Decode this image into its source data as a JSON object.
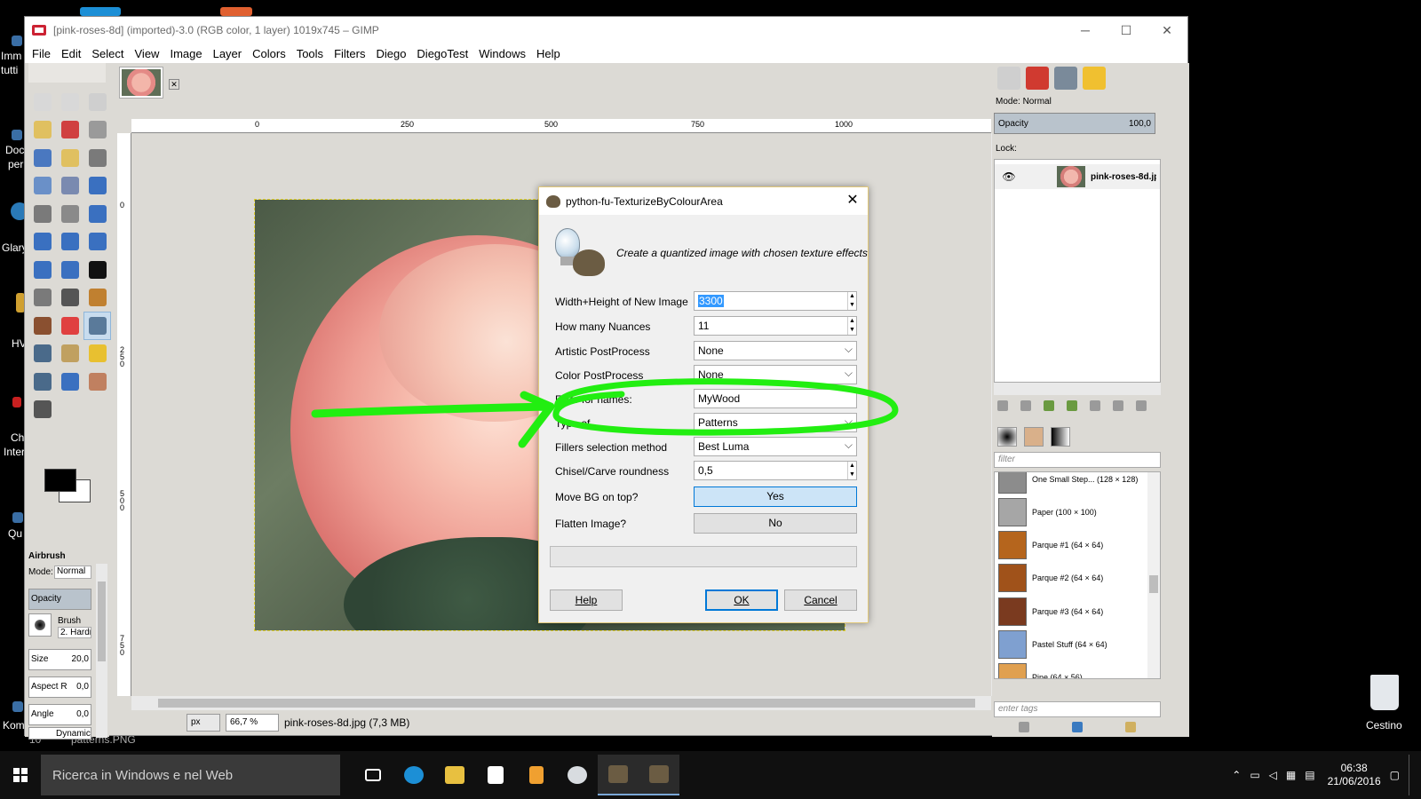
{
  "desktop": {
    "left_labels": [
      "Imm",
      "tutti",
      "Doc",
      "per",
      "Glary",
      "HV",
      "Ch",
      "Inter",
      "Qu",
      "Kom",
      "10"
    ],
    "bottom_label": "patterns.PNG",
    "recycle_bin": "Cestino"
  },
  "window": {
    "title": "[pink-roses-8d] (imported)-3.0 (RGB color, 1 layer) 1019x745 – GIMP",
    "controls": [
      "─",
      "☐",
      "✕"
    ]
  },
  "menu": [
    "File",
    "Edit",
    "Select",
    "View",
    "Image",
    "Layer",
    "Colors",
    "Tools",
    "Filters",
    "Diego",
    "DiegoTest",
    "Windows",
    "Help"
  ],
  "toolbox": {
    "tools": [
      {
        "name": "rect-select-icon",
        "color": "#d8d8d8"
      },
      {
        "name": "ellipse-select-icon",
        "color": "#d8d8d8"
      },
      {
        "name": "free-select-icon",
        "color": "#cfcfcf"
      },
      {
        "name": "fuzzy-select-icon",
        "color": "#e0c060"
      },
      {
        "name": "select-by-color-icon",
        "color": "#d04040"
      },
      {
        "name": "scissors-icon",
        "color": "#9a9a9a"
      },
      {
        "name": "foreground-select-icon",
        "color": "#4a78c0"
      },
      {
        "name": "paths-icon",
        "color": "#e0c060"
      },
      {
        "name": "color-picker-icon",
        "color": "#7a7a7a"
      },
      {
        "name": "zoom-icon",
        "color": "#6a90c8"
      },
      {
        "name": "measure-icon",
        "color": "#7a8ab0"
      },
      {
        "name": "move-icon",
        "color": "#3a70c0"
      },
      {
        "name": "align-icon",
        "color": "#7a7a7a"
      },
      {
        "name": "crop-icon",
        "color": "#8a8a8a"
      },
      {
        "name": "rotate-icon",
        "color": "#3a70c0"
      },
      {
        "name": "scale-icon",
        "color": "#3a70c0"
      },
      {
        "name": "shear-icon",
        "color": "#3a70c0"
      },
      {
        "name": "perspective-icon",
        "color": "#3a70c0"
      },
      {
        "name": "flip-icon",
        "color": "#3a70c0"
      },
      {
        "name": "cage-icon",
        "color": "#3a70c0"
      },
      {
        "name": "text-icon",
        "color": "#111111"
      },
      {
        "name": "bucket-fill-icon",
        "color": "#7a7a7a"
      },
      {
        "name": "blend-icon",
        "color": "#555555"
      },
      {
        "name": "pencil-icon",
        "color": "#c08030"
      },
      {
        "name": "paintbrush-icon",
        "color": "#8a5030"
      },
      {
        "name": "eraser-icon",
        "color": "#e04040"
      },
      {
        "name": "airbrush-icon",
        "color": "#5a7a9a"
      },
      {
        "name": "ink-icon",
        "color": "#4a6a8a"
      },
      {
        "name": "clone-icon",
        "color": "#c0a060"
      },
      {
        "name": "heal-icon",
        "color": "#e8c030"
      },
      {
        "name": "perspective-clone-icon",
        "color": "#4a6a8a"
      },
      {
        "name": "blur-icon",
        "color": "#3a70c0"
      },
      {
        "name": "smudge-icon",
        "color": "#c08060"
      },
      {
        "name": "dodge-burn-icon",
        "color": "#555555"
      }
    ],
    "active_tool_index": 26
  },
  "tool_options": {
    "title": "Airbrush",
    "mode_label": "Mode:",
    "mode_value": "Normal",
    "opacity_label": "Opacity",
    "brush_label": "Brush",
    "brush_name": "2. Hardn",
    "size_label": "Size",
    "size_value": "20,0",
    "aspect_label": "Aspect R",
    "aspect_value": "0,0",
    "angle_label": "Angle",
    "angle_value": "0,0",
    "dynamics_label": "Dynamic"
  },
  "rulers": {
    "h_labels": [
      "0",
      "250",
      "500",
      "750",
      "1000"
    ],
    "v_labels": [
      "0",
      "2 5 0",
      "5 0 0",
      "7 5 0"
    ]
  },
  "status": {
    "unit": "px",
    "zoom": "66,7 %",
    "file": "pink-roses-8d.jpg (7,3 MB)"
  },
  "layers_dock": {
    "mode_label": "Mode:",
    "mode_value": "Normal",
    "opacity_label": "Opacity",
    "opacity_value": "100,0",
    "lock_label": "Lock:",
    "layer_name": "pink-roses-8d.jp"
  },
  "patterns_dock": {
    "filter_placeholder": "filter",
    "tags_placeholder": "enter tags",
    "items": [
      {
        "name": "One Small Step... (128 × 128)",
        "color": "#8c8c8c"
      },
      {
        "name": "Paper (100 × 100)",
        "color": "#a6a6a6"
      },
      {
        "name": "Parque #1 (64 × 64)",
        "color": "#b5651d"
      },
      {
        "name": "Parque #2 (64 × 64)",
        "color": "#a0521a"
      },
      {
        "name": "Parque #3 (64 × 64)",
        "color": "#7a3a1f"
      },
      {
        "name": "Pastel Stuff (64 × 64)",
        "color": "#7fa0d0"
      },
      {
        "name": "Pine (64 × 56)",
        "color": "#e0a050"
      }
    ]
  },
  "dialog": {
    "title": "python-fu-TexturizeByColourArea",
    "description": "Create a quantized image with chosen texture effects",
    "fields": {
      "width_height_label": "Width+Height of New Image",
      "width_height_value": "3300",
      "nuances_label": "How many Nuances",
      "nuances_value": "11",
      "artistic_label": "Artistic PostProcess",
      "artistic_value": "None",
      "color_label": "Color PostProcess",
      "color_value": "None",
      "filter_label": "Filter for names:",
      "filter_value": "MyWood",
      "type_label": "Type of",
      "type_value": "Patterns",
      "fillers_label": "Fillers selection method",
      "fillers_value": "Best Luma",
      "chisel_label": "Chisel/Carve roundness",
      "chisel_value": "0,5",
      "movebg_label": "Move BG on top?",
      "movebg_value": "Yes",
      "flatten_label": "Flatten Image?",
      "flatten_value": "No"
    },
    "buttons": {
      "help": "Help",
      "ok": "OK",
      "cancel": "Cancel"
    }
  },
  "annotation": {
    "color": "#22ee11"
  },
  "taskbar": {
    "search_placeholder": "Ricerca in Windows e nel Web",
    "time": "06:38",
    "date": "21/06/2016"
  }
}
